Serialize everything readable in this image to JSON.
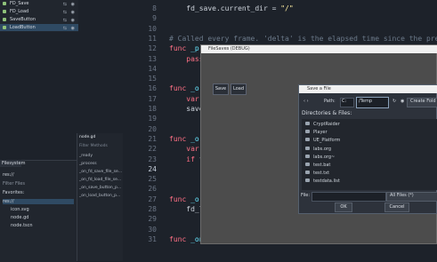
{
  "scene_tree": {
    "items": [
      {
        "label": "FD_Save"
      },
      {
        "label": "FD_Load"
      },
      {
        "label": "SaveButton"
      },
      {
        "label": "LoadButton"
      }
    ]
  },
  "filesystem": {
    "tab": "Filesystem",
    "path": "res://",
    "filter_placeholder": "Filter Files",
    "favorites": "Favorites:",
    "items": [
      "res://",
      "icon.svg",
      "node.gd",
      "node.tscn"
    ]
  },
  "script_list": {
    "file": "node.gd",
    "filter_placeholder": "Filter Methods",
    "methods": [
      "_ready",
      "_process",
      "_on_fd_save_file_se...",
      "_on_fd_load_file_se...",
      "_on_save_button_p...",
      "_on_load_button_p..."
    ]
  },
  "editor": {
    "lines": [
      {
        "num": "8",
        "text": "    fd_save.current_dir = \"/\""
      },
      {
        "num": "9",
        "text": ""
      },
      {
        "num": "10",
        "text": ""
      },
      {
        "num": "11",
        "text": "# Called every frame. 'delta' is the elapsed time since the previ"
      },
      {
        "num": "12",
        "text": "func _p"
      },
      {
        "num": "13",
        "text": "    pass"
      },
      {
        "num": "14",
        "text": ""
      },
      {
        "num": "15",
        "text": ""
      },
      {
        "num": "16",
        "text": "func _o"
      },
      {
        "num": "17",
        "text": "    var"
      },
      {
        "num": "18",
        "text": "    save"
      },
      {
        "num": "19",
        "text": ""
      },
      {
        "num": "20",
        "text": ""
      },
      {
        "num": "21",
        "text": "func _o"
      },
      {
        "num": "22",
        "text": "    var"
      },
      {
        "num": "23",
        "text": "    if f"
      },
      {
        "num": "24",
        "text": ""
      },
      {
        "num": "25",
        "text": ""
      },
      {
        "num": "26",
        "text": ""
      },
      {
        "num": "27",
        "text": "func _o"
      },
      {
        "num": "28",
        "text": "    fd_l"
      },
      {
        "num": "29",
        "text": ""
      },
      {
        "num": "30",
        "text": ""
      },
      {
        "num": "31",
        "text": "func _on_load_button_pressed():"
      }
    ]
  },
  "game_window": {
    "title": "FileSaves (DEBUG)",
    "save_label": "Save",
    "load_label": "Load"
  },
  "save_dialog": {
    "title": "Save a File",
    "path_label": "Path:",
    "drive": "C:",
    "path_value": "/Temp",
    "create_folder_label": "Create Fold",
    "section_label": "Directories & Files:",
    "files": [
      "CryptRaider",
      "Player",
      "UE_Platform",
      "labs.org",
      "labs.org~",
      "test.bat",
      "test.txt",
      "testdata.list"
    ],
    "file_label": "File:",
    "filter_value": "All Files (*)",
    "ok_label": "OK",
    "cancel_label": "Cancel"
  }
}
